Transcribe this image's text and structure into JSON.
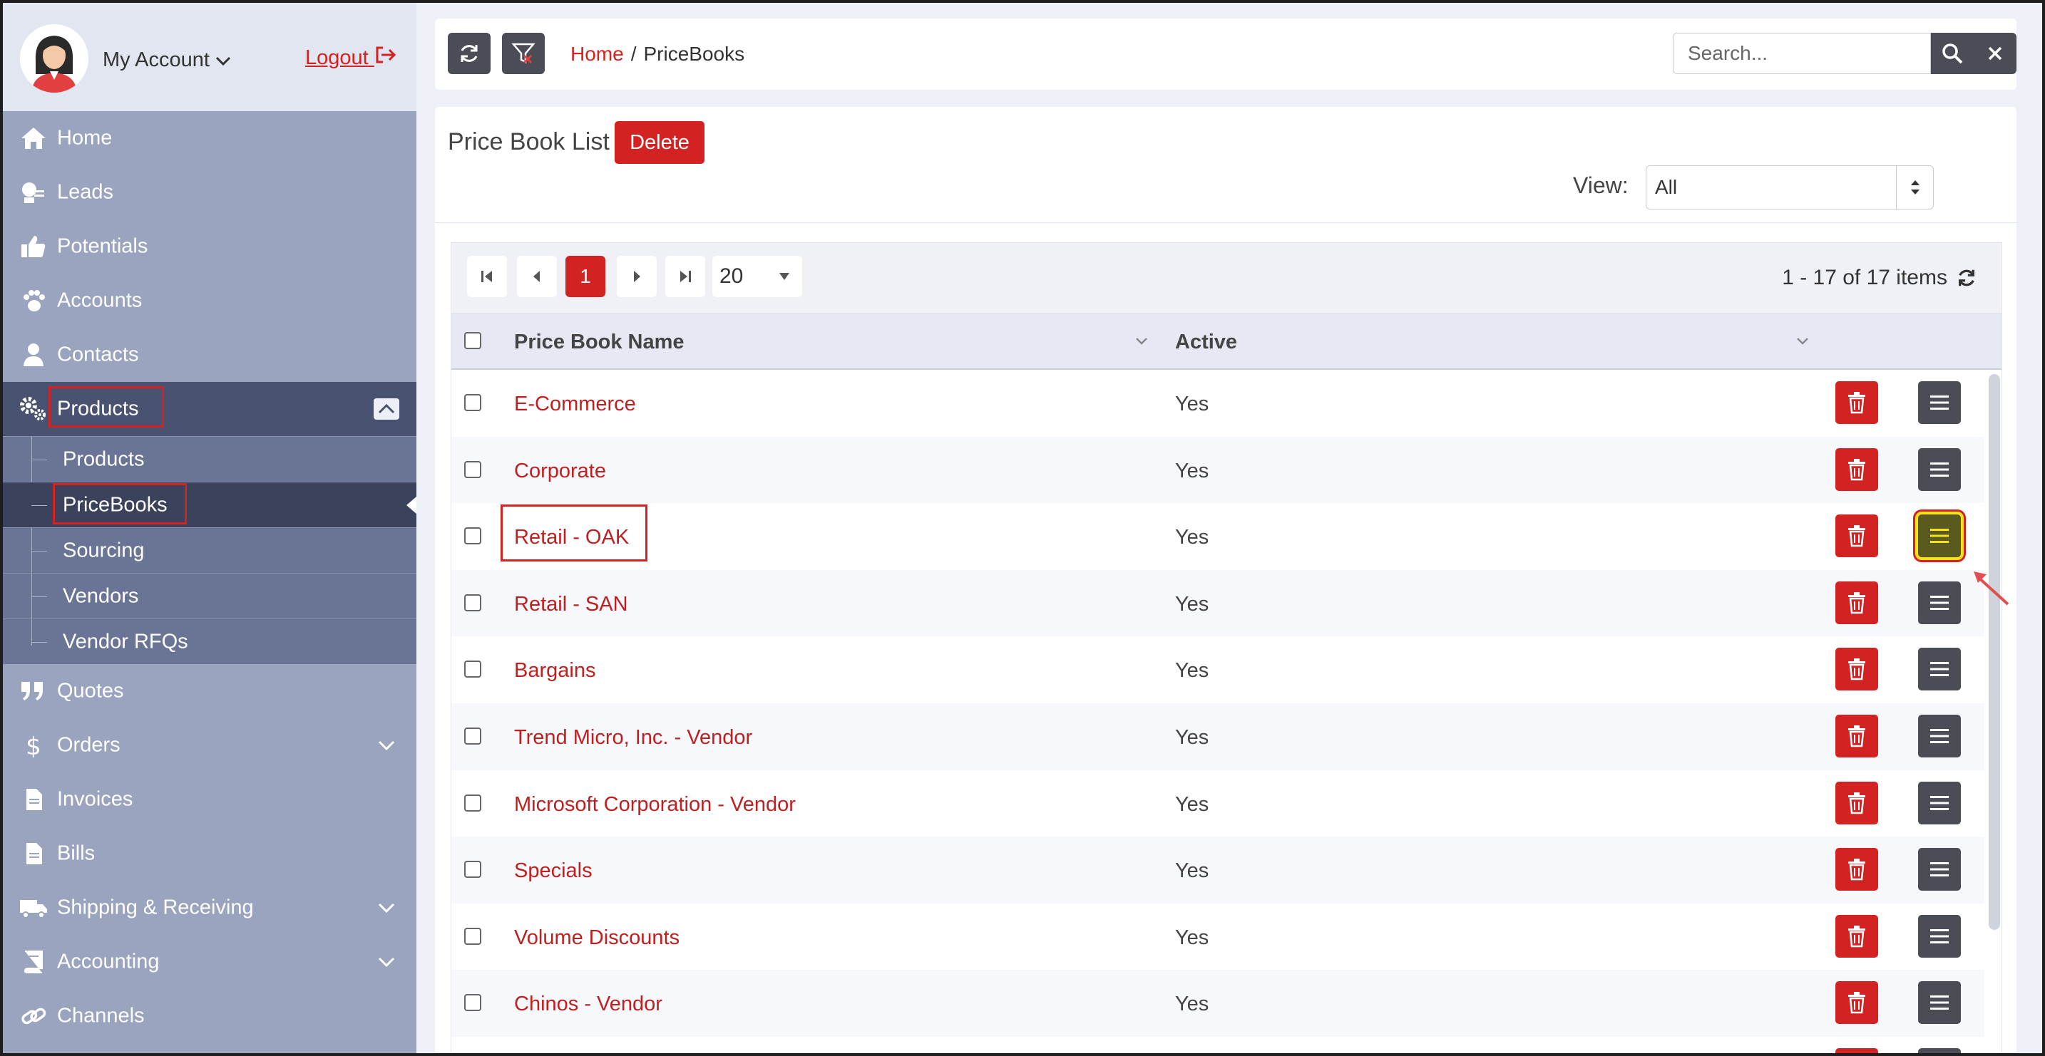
{
  "account": {
    "my_account_label": "My Account",
    "logout_label": "Logout"
  },
  "sidebar": {
    "items": [
      {
        "label": "Home",
        "icon": "home-icon"
      },
      {
        "label": "Leads",
        "icon": "leads-icon"
      },
      {
        "label": "Potentials",
        "icon": "thumbs-up-icon"
      },
      {
        "label": "Accounts",
        "icon": "paw-icon"
      },
      {
        "label": "Contacts",
        "icon": "user-icon"
      },
      {
        "label": "Products",
        "icon": "gears-icon",
        "expanded": true
      },
      {
        "label": "Quotes",
        "icon": "quote-icon"
      },
      {
        "label": "Orders",
        "icon": "dollar-icon"
      },
      {
        "label": "Invoices",
        "icon": "file-icon"
      },
      {
        "label": "Bills",
        "icon": "file-icon"
      },
      {
        "label": "Shipping & Receiving",
        "icon": "truck-icon"
      },
      {
        "label": "Accounting",
        "icon": "book-icon"
      },
      {
        "label": "Channels",
        "icon": "link-icon"
      }
    ],
    "products_sub": [
      "Products",
      "PriceBooks",
      "Sourcing",
      "Vendors",
      "Vendor RFQs"
    ],
    "active_sub": "PriceBooks"
  },
  "toolbar": {
    "breadcrumb_home": "Home",
    "breadcrumb_sep": "/",
    "breadcrumb_current": "PriceBooks",
    "search_placeholder": "Search..."
  },
  "page": {
    "title": "Price Book List",
    "delete_label": "Delete",
    "view_label": "View:",
    "view_value": "All"
  },
  "pager": {
    "current_page": "1",
    "page_size": "20",
    "info": "1 - 17 of 17 items"
  },
  "table": {
    "columns": [
      "Price Book Name",
      "Active"
    ],
    "rows": [
      {
        "name": "E-Commerce",
        "active": "Yes"
      },
      {
        "name": "Corporate",
        "active": "Yes"
      },
      {
        "name": "Retail - OAK",
        "active": "Yes"
      },
      {
        "name": "Retail - SAN",
        "active": "Yes"
      },
      {
        "name": "Bargains",
        "active": "Yes"
      },
      {
        "name": "Trend Micro, Inc. - Vendor",
        "active": "Yes"
      },
      {
        "name": "Microsoft Corporation - Vendor",
        "active": "Yes"
      },
      {
        "name": "Specials",
        "active": "Yes"
      },
      {
        "name": "Volume Discounts",
        "active": "Yes"
      },
      {
        "name": "Chinos - Vendor",
        "active": "Yes"
      }
    ]
  },
  "colors": {
    "accent": "#d32222",
    "sidebar": "#9aa4bf",
    "sidebar_active": "#4a5271",
    "button_dark": "#4a4d55",
    "highlight": "#f3e11a"
  }
}
